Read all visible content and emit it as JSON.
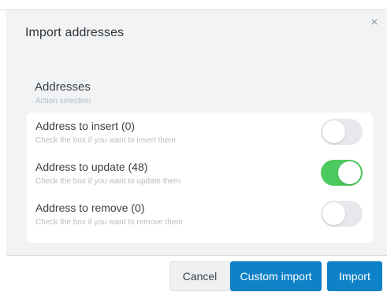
{
  "dialog": {
    "title": "Import addresses",
    "close_glyph": "×"
  },
  "section": {
    "title": "Addresses",
    "subtitle": "Action selection"
  },
  "rows": [
    {
      "label": "Address to insert (0)",
      "help": "Check the box if you want to insert them",
      "enabled": false
    },
    {
      "label": "Address to update (48)",
      "help": "Check the box if you want to update them",
      "enabled": true
    },
    {
      "label": "Address to remove (0)",
      "help": "Check the box if you want to remove them",
      "enabled": false
    }
  ],
  "footer": {
    "cancel_label": "Cancel",
    "custom_import_label": "Custom import",
    "import_label": "Import"
  },
  "colors": {
    "primary": "#0f81c7",
    "toggle_on": "#4cca5f",
    "toggle_off": "#e6e8eb"
  }
}
